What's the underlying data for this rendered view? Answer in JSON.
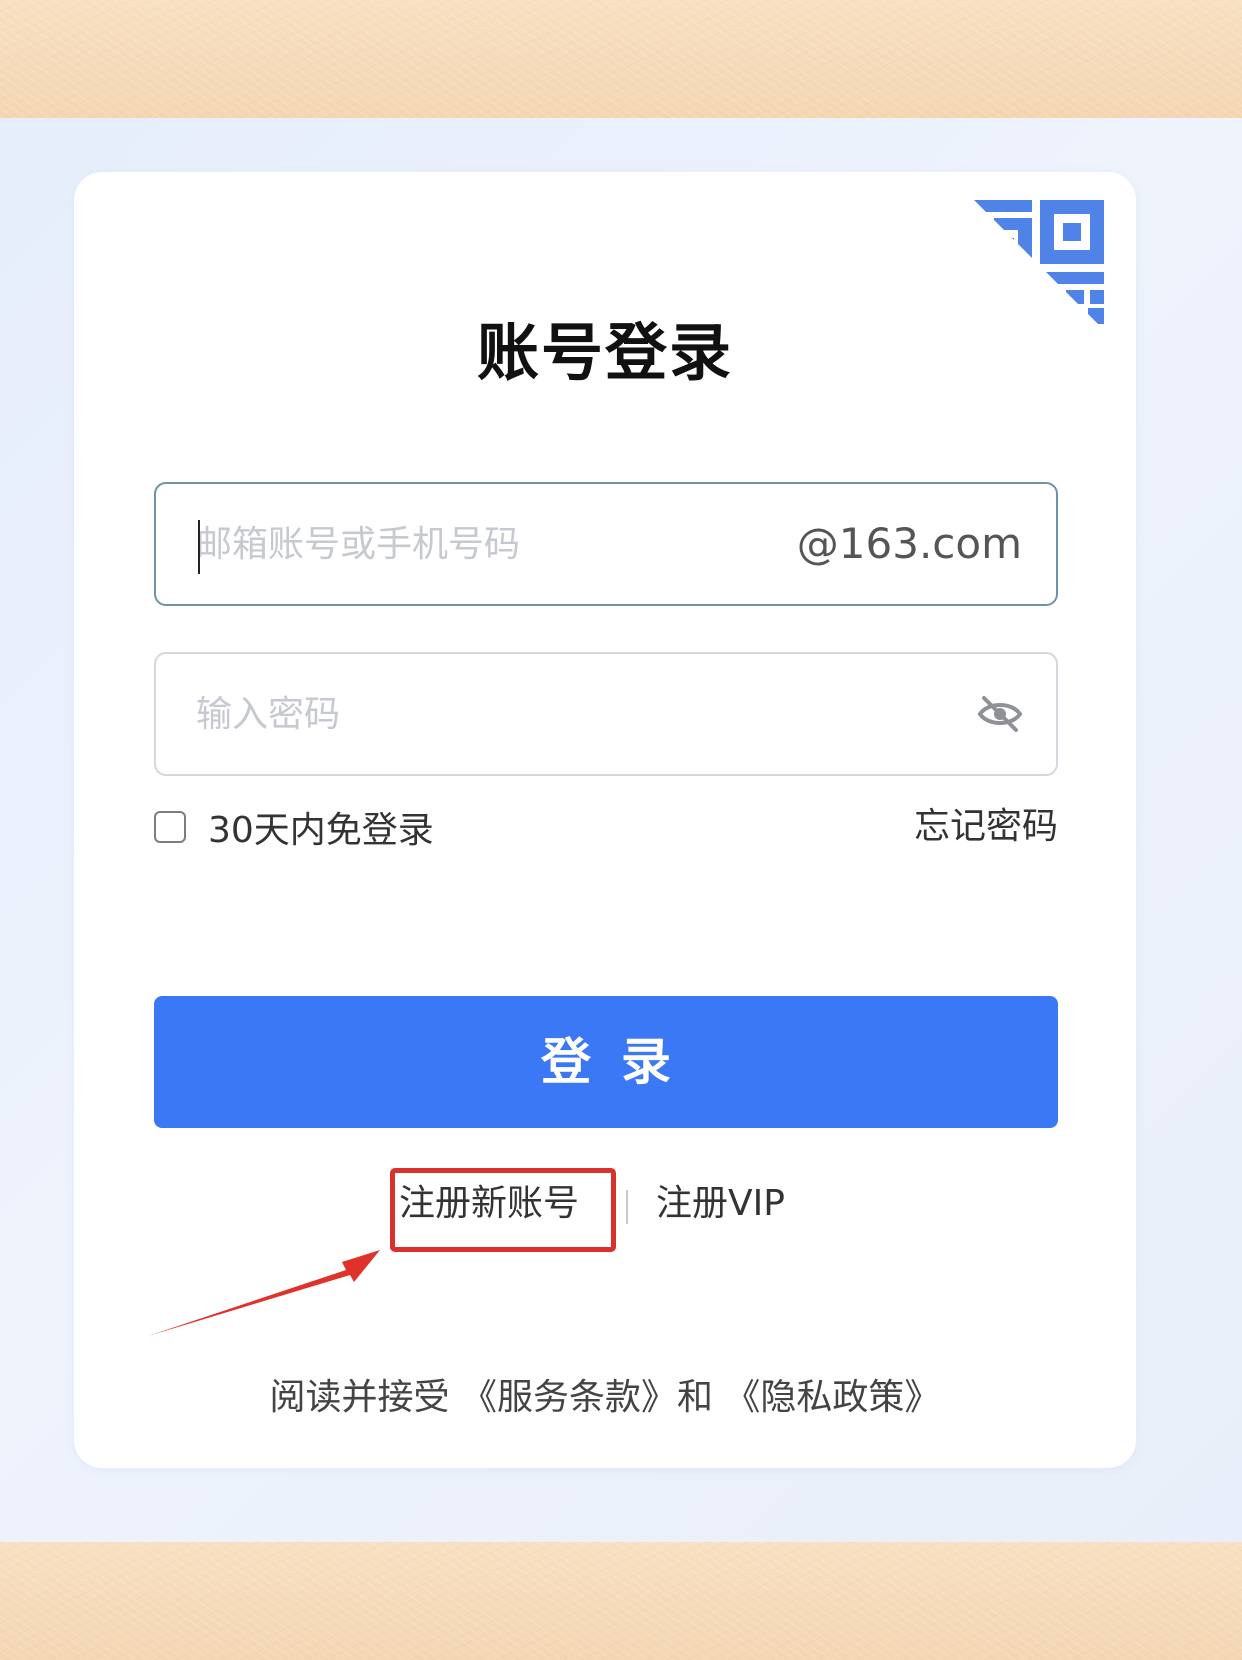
{
  "login": {
    "title": "账号登录",
    "email_placeholder": "邮箱账号或手机号码",
    "email_suffix": "@163.com",
    "password_placeholder": "输入密码",
    "remember_label": "30天内免登录",
    "remember_checked": false,
    "forgot_label": "忘记密码",
    "login_button": "登录",
    "register_label": "注册新账号",
    "vip_label": "注册VIP",
    "terms_text": "阅读并接受 《服务条款》和 《隐私政策》"
  },
  "colors": {
    "primary_button": "#3b78f5",
    "highlight": "#d9312b",
    "qr_icon": "#4f83e8"
  },
  "icons": {
    "qr": "qr-code-icon",
    "eye": "eye-hidden-icon",
    "arrow": "annotation-arrow-icon"
  }
}
